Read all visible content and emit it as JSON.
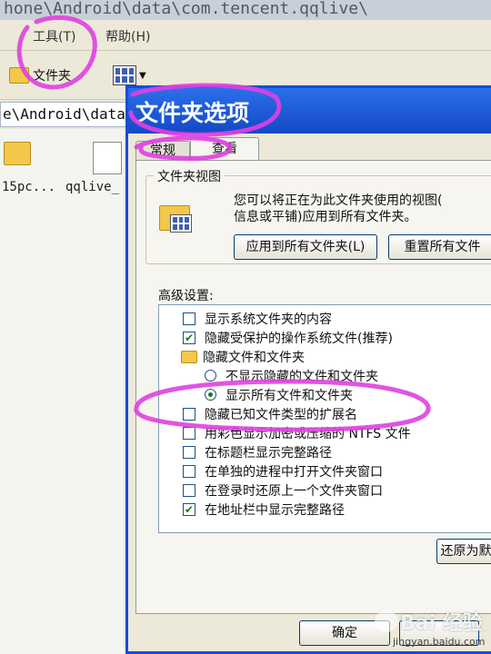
{
  "explorer": {
    "path_text": "hone\\Android\\data\\com.tencent.qqlive\\",
    "menu": {
      "tools": "工具(T)",
      "help": "帮助(H)"
    },
    "toolbar": {
      "folders_label": "文件夹"
    },
    "address": "e\\Android\\data",
    "files": [
      {
        "name": "15pc..."
      },
      {
        "name": "qqlive_"
      }
    ]
  },
  "dialog": {
    "title": "文件夹选项",
    "tabs": [
      "常规",
      "查看"
    ],
    "folder_views": {
      "label": "文件夹视图",
      "description_line1": "您可以将正在为此文件夹使用的视图(",
      "description_line2": "信息或平铺)应用到所有文件夹。",
      "apply_button": "应用到所有文件夹(L)",
      "reset_button": "重置所有文件"
    },
    "advanced_label": "高级设置:",
    "settings": [
      {
        "kind": "checkbox",
        "label": "显示系统文件夹的内容",
        "checked": false
      },
      {
        "kind": "checkbox",
        "label": "隐藏受保护的操作系统文件(推荐)",
        "checked": true
      },
      {
        "kind": "folder",
        "label": "隐藏文件和文件夹"
      },
      {
        "kind": "radio",
        "label": "不显示隐藏的文件和文件夹",
        "checked": false
      },
      {
        "kind": "radio",
        "label": "显示所有文件和文件夹",
        "checked": true
      },
      {
        "kind": "checkbox",
        "label": "隐藏已知文件类型的扩展名",
        "checked": false
      },
      {
        "kind": "checkbox",
        "label": "用彩色显示加密或压缩的 NTFS 文件",
        "checked": false
      },
      {
        "kind": "checkbox",
        "label": "在标题栏显示完整路径",
        "checked": false
      },
      {
        "kind": "checkbox",
        "label": "在单独的进程中打开文件夹窗口",
        "checked": false
      },
      {
        "kind": "checkbox",
        "label": "在登录时还原上一个文件夹窗口",
        "checked": false
      },
      {
        "kind": "checkbox",
        "label": "在地址栏中显示完整路径",
        "checked": true
      }
    ],
    "restore_defaults_button": "还原为默",
    "ok_button": "确定"
  },
  "watermark": {
    "brand": "Bai 经验",
    "site": "jingyan.baidu.com"
  },
  "colors": {
    "titlebar": "#1448c6",
    "annotation": "#e040e0"
  }
}
